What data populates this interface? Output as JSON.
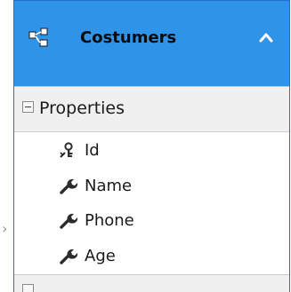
{
  "diagram": {
    "connector_glyph": "›",
    "entity": {
      "title": "Costumers",
      "header_color": "#2f93e8",
      "icon": "entity-icon",
      "collapse_icon": "chevron-up-icon",
      "sections": [
        {
          "label": "Properties",
          "expanded": true,
          "properties": [
            {
              "label": "Id",
              "icon": "key-icon"
            },
            {
              "label": "Name",
              "icon": "wrench-icon"
            },
            {
              "label": "Phone",
              "icon": "wrench-icon"
            },
            {
              "label": "Age",
              "icon": "wrench-icon"
            }
          ]
        },
        {
          "label": "",
          "expanded": false
        }
      ]
    }
  }
}
